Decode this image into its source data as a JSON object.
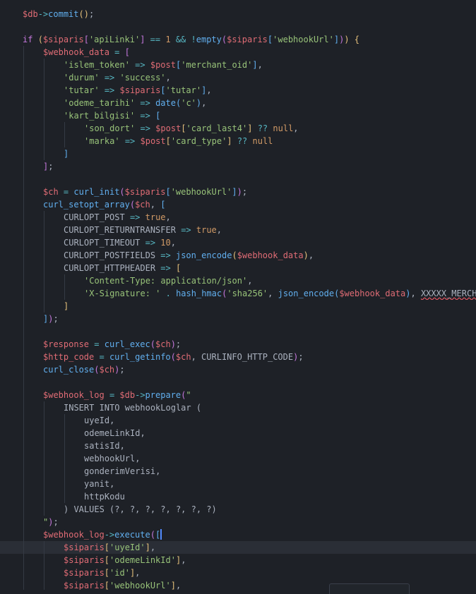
{
  "editor": {
    "language": "php",
    "theme": {
      "background": "#1e2127",
      "active_line": "#2a2e36",
      "variable": "#e06c75",
      "operator": "#56b6c2",
      "function": "#61afef",
      "keyword": "#c678dd",
      "string": "#98c379",
      "number": "#d19a66",
      "plain": "#abb2bf",
      "caret": "#528bff",
      "error_underline": "#e05561"
    },
    "active_line": 42,
    "lines": [
      {
        "indent": 0,
        "tokens": [
          [
            "var",
            "$db"
          ],
          [
            "op",
            "->"
          ],
          [
            "fn",
            "commit"
          ],
          [
            "br1",
            "()"
          ],
          [
            "punc",
            ";"
          ]
        ]
      },
      {
        "indent": 0,
        "tokens": []
      },
      {
        "indent": 0,
        "tokens": [
          [
            "kw",
            "if"
          ],
          [
            "plain",
            " "
          ],
          [
            "br1",
            "("
          ],
          [
            "var",
            "$siparis"
          ],
          [
            "br2",
            "["
          ],
          [
            "str",
            "'apiLinki'"
          ],
          [
            "br2",
            "]"
          ],
          [
            "plain",
            " "
          ],
          [
            "op",
            "=="
          ],
          [
            "plain",
            " "
          ],
          [
            "num",
            "1"
          ],
          [
            "plain",
            " "
          ],
          [
            "op",
            "&&"
          ],
          [
            "plain",
            " "
          ],
          [
            "op",
            "!"
          ],
          [
            "fn",
            "empty"
          ],
          [
            "br2",
            "("
          ],
          [
            "var",
            "$siparis"
          ],
          [
            "br3",
            "["
          ],
          [
            "str",
            "'webhookUrl'"
          ],
          [
            "br3",
            "]"
          ],
          [
            "br2",
            ")"
          ],
          [
            "br1",
            ")"
          ],
          [
            "plain",
            " "
          ],
          [
            "br1",
            "{"
          ]
        ]
      },
      {
        "indent": 1,
        "tokens": [
          [
            "var",
            "$webhook_data"
          ],
          [
            "plain",
            " "
          ],
          [
            "op",
            "="
          ],
          [
            "plain",
            " "
          ],
          [
            "br2",
            "["
          ]
        ]
      },
      {
        "indent": 2,
        "tokens": [
          [
            "str",
            "'islem_token'"
          ],
          [
            "plain",
            " "
          ],
          [
            "op",
            "=>"
          ],
          [
            "plain",
            " "
          ],
          [
            "var",
            "$post"
          ],
          [
            "br3",
            "["
          ],
          [
            "str",
            "'merchant_oid'"
          ],
          [
            "br3",
            "]"
          ],
          [
            "punc",
            ","
          ]
        ]
      },
      {
        "indent": 2,
        "tokens": [
          [
            "str",
            "'durum'"
          ],
          [
            "plain",
            " "
          ],
          [
            "op",
            "=>"
          ],
          [
            "plain",
            " "
          ],
          [
            "str",
            "'success'"
          ],
          [
            "punc",
            ","
          ]
        ]
      },
      {
        "indent": 2,
        "tokens": [
          [
            "str",
            "'tutar'"
          ],
          [
            "plain",
            " "
          ],
          [
            "op",
            "=>"
          ],
          [
            "plain",
            " "
          ],
          [
            "var",
            "$siparis"
          ],
          [
            "br3",
            "["
          ],
          [
            "str",
            "'tutar'"
          ],
          [
            "br3",
            "]"
          ],
          [
            "punc",
            ","
          ]
        ]
      },
      {
        "indent": 2,
        "tokens": [
          [
            "str",
            "'odeme_tarihi'"
          ],
          [
            "plain",
            " "
          ],
          [
            "op",
            "=>"
          ],
          [
            "plain",
            " "
          ],
          [
            "fn",
            "date"
          ],
          [
            "br3",
            "("
          ],
          [
            "str",
            "'c'"
          ],
          [
            "br3",
            ")"
          ],
          [
            "punc",
            ","
          ]
        ]
      },
      {
        "indent": 2,
        "tokens": [
          [
            "str",
            "'kart_bilgisi'"
          ],
          [
            "plain",
            " "
          ],
          [
            "op",
            "=>"
          ],
          [
            "plain",
            " "
          ],
          [
            "br3",
            "["
          ]
        ]
      },
      {
        "indent": 3,
        "tokens": [
          [
            "str",
            "'son_dort'"
          ],
          [
            "plain",
            " "
          ],
          [
            "op",
            "=>"
          ],
          [
            "plain",
            " "
          ],
          [
            "var",
            "$post"
          ],
          [
            "br1",
            "["
          ],
          [
            "str",
            "'card_last4'"
          ],
          [
            "br1",
            "]"
          ],
          [
            "plain",
            " "
          ],
          [
            "op",
            "??"
          ],
          [
            "plain",
            " "
          ],
          [
            "const",
            "null"
          ],
          [
            "punc",
            ","
          ]
        ]
      },
      {
        "indent": 3,
        "tokens": [
          [
            "str",
            "'marka'"
          ],
          [
            "plain",
            " "
          ],
          [
            "op",
            "=>"
          ],
          [
            "plain",
            " "
          ],
          [
            "var",
            "$post"
          ],
          [
            "br1",
            "["
          ],
          [
            "str",
            "'card_type'"
          ],
          [
            "br1",
            "]"
          ],
          [
            "plain",
            " "
          ],
          [
            "op",
            "??"
          ],
          [
            "plain",
            " "
          ],
          [
            "const",
            "null"
          ]
        ]
      },
      {
        "indent": 2,
        "tokens": [
          [
            "br3",
            "]"
          ]
        ]
      },
      {
        "indent": 1,
        "tokens": [
          [
            "br2",
            "]"
          ],
          [
            "punc",
            ";"
          ]
        ]
      },
      {
        "indent": 1,
        "tokens": []
      },
      {
        "indent": 1,
        "tokens": [
          [
            "var",
            "$ch"
          ],
          [
            "plain",
            " "
          ],
          [
            "op",
            "="
          ],
          [
            "plain",
            " "
          ],
          [
            "fn",
            "curl_init"
          ],
          [
            "br2",
            "("
          ],
          [
            "var",
            "$siparis"
          ],
          [
            "br3",
            "["
          ],
          [
            "str",
            "'webhookUrl'"
          ],
          [
            "br3",
            "]"
          ],
          [
            "br2",
            ")"
          ],
          [
            "punc",
            ";"
          ]
        ]
      },
      {
        "indent": 1,
        "tokens": [
          [
            "fn",
            "curl_setopt_array"
          ],
          [
            "br2",
            "("
          ],
          [
            "var",
            "$ch"
          ],
          [
            "punc",
            ","
          ],
          [
            "plain",
            " "
          ],
          [
            "br3",
            "["
          ]
        ]
      },
      {
        "indent": 2,
        "tokens": [
          [
            "plain",
            "CURLOPT_POST"
          ],
          [
            "plain",
            " "
          ],
          [
            "op",
            "=>"
          ],
          [
            "plain",
            " "
          ],
          [
            "const",
            "true"
          ],
          [
            "punc",
            ","
          ]
        ]
      },
      {
        "indent": 2,
        "tokens": [
          [
            "plain",
            "CURLOPT_RETURNTRANSFER"
          ],
          [
            "plain",
            " "
          ],
          [
            "op",
            "=>"
          ],
          [
            "plain",
            " "
          ],
          [
            "const",
            "true"
          ],
          [
            "punc",
            ","
          ]
        ]
      },
      {
        "indent": 2,
        "tokens": [
          [
            "plain",
            "CURLOPT_TIMEOUT"
          ],
          [
            "plain",
            " "
          ],
          [
            "op",
            "=>"
          ],
          [
            "plain",
            " "
          ],
          [
            "num",
            "10"
          ],
          [
            "punc",
            ","
          ]
        ]
      },
      {
        "indent": 2,
        "tokens": [
          [
            "plain",
            "CURLOPT_POSTFIELDS"
          ],
          [
            "plain",
            " "
          ],
          [
            "op",
            "=>"
          ],
          [
            "plain",
            " "
          ],
          [
            "fn",
            "json_encode"
          ],
          [
            "br1",
            "("
          ],
          [
            "var",
            "$webhook_data"
          ],
          [
            "br1",
            ")"
          ],
          [
            "punc",
            ","
          ]
        ]
      },
      {
        "indent": 2,
        "tokens": [
          [
            "plain",
            "CURLOPT_HTTPHEADER"
          ],
          [
            "plain",
            " "
          ],
          [
            "op",
            "=>"
          ],
          [
            "plain",
            " "
          ],
          [
            "br1",
            "["
          ]
        ]
      },
      {
        "indent": 3,
        "tokens": [
          [
            "str",
            "'Content-Type: application/json'"
          ],
          [
            "punc",
            ","
          ]
        ]
      },
      {
        "indent": 3,
        "tokens": [
          [
            "str",
            "'X-Signature: '"
          ],
          [
            "plain",
            " "
          ],
          [
            "op",
            "."
          ],
          [
            "plain",
            " "
          ],
          [
            "fn",
            "hash_hmac"
          ],
          [
            "br2",
            "("
          ],
          [
            "str",
            "'sha256'"
          ],
          [
            "punc",
            ","
          ],
          [
            "plain",
            " "
          ],
          [
            "fn",
            "json_encode"
          ],
          [
            "br3",
            "("
          ],
          [
            "var",
            "$webhook_data"
          ],
          [
            "br3",
            ")"
          ],
          [
            "punc",
            ","
          ],
          [
            "plain",
            " "
          ],
          [
            "err",
            "XXXXX_MERCHANT_KEY"
          ]
        ]
      },
      {
        "indent": 2,
        "tokens": [
          [
            "br1",
            "]"
          ]
        ]
      },
      {
        "indent": 1,
        "tokens": [
          [
            "br3",
            "]"
          ],
          [
            "br2",
            ")"
          ],
          [
            "punc",
            ";"
          ]
        ]
      },
      {
        "indent": 1,
        "tokens": []
      },
      {
        "indent": 1,
        "tokens": [
          [
            "var",
            "$response"
          ],
          [
            "plain",
            " "
          ],
          [
            "op",
            "="
          ],
          [
            "plain",
            " "
          ],
          [
            "fn",
            "curl_exec"
          ],
          [
            "br2",
            "("
          ],
          [
            "var",
            "$ch"
          ],
          [
            "br2",
            ")"
          ],
          [
            "punc",
            ";"
          ]
        ]
      },
      {
        "indent": 1,
        "tokens": [
          [
            "var",
            "$http_code"
          ],
          [
            "plain",
            " "
          ],
          [
            "op",
            "="
          ],
          [
            "plain",
            " "
          ],
          [
            "fn",
            "curl_getinfo"
          ],
          [
            "br2",
            "("
          ],
          [
            "var",
            "$ch"
          ],
          [
            "punc",
            ","
          ],
          [
            "plain",
            " "
          ],
          [
            "plain",
            "CURLINFO_HTTP_CODE"
          ],
          [
            "br2",
            ")"
          ],
          [
            "punc",
            ";"
          ]
        ]
      },
      {
        "indent": 1,
        "tokens": [
          [
            "fn",
            "curl_close"
          ],
          [
            "br2",
            "("
          ],
          [
            "var",
            "$ch"
          ],
          [
            "br2",
            ")"
          ],
          [
            "punc",
            ";"
          ]
        ]
      },
      {
        "indent": 1,
        "tokens": []
      },
      {
        "indent": 1,
        "tokens": [
          [
            "var",
            "$webhook_log"
          ],
          [
            "plain",
            " "
          ],
          [
            "op",
            "="
          ],
          [
            "plain",
            " "
          ],
          [
            "var",
            "$db"
          ],
          [
            "op",
            "->"
          ],
          [
            "fn",
            "prepare"
          ],
          [
            "br2",
            "("
          ],
          [
            "str",
            "\""
          ]
        ]
      },
      {
        "indent": 2,
        "tokens": [
          [
            "plain",
            "INSERT INTO webhookLoglar ("
          ]
        ]
      },
      {
        "indent": 3,
        "tokens": [
          [
            "plain",
            "uyeId,"
          ]
        ]
      },
      {
        "indent": 3,
        "tokens": [
          [
            "plain",
            "odemeLinkId,"
          ]
        ]
      },
      {
        "indent": 3,
        "tokens": [
          [
            "plain",
            "satisId,"
          ]
        ]
      },
      {
        "indent": 3,
        "tokens": [
          [
            "plain",
            "webhookUrl,"
          ]
        ]
      },
      {
        "indent": 3,
        "tokens": [
          [
            "plain",
            "gonderimVerisi,"
          ]
        ]
      },
      {
        "indent": 3,
        "tokens": [
          [
            "plain",
            "yanit,"
          ]
        ]
      },
      {
        "indent": 3,
        "tokens": [
          [
            "plain",
            "httpKodu"
          ]
        ]
      },
      {
        "indent": 2,
        "tokens": [
          [
            "plain",
            ") VALUES (?, ?, ?, ?, ?, ?, ?)"
          ]
        ]
      },
      {
        "indent": 1,
        "tokens": [
          [
            "str",
            "\""
          ],
          [
            "br2",
            ")"
          ],
          [
            "punc",
            ";"
          ]
        ]
      },
      {
        "indent": 1,
        "tokens": [
          [
            "var",
            "$webhook_log"
          ],
          [
            "op",
            "->"
          ],
          [
            "fn",
            "execute"
          ],
          [
            "br2",
            "("
          ],
          [
            "br3",
            "["
          ],
          [
            "caret",
            ""
          ]
        ]
      },
      {
        "indent": 2,
        "tokens": [
          [
            "var",
            "$siparis"
          ],
          [
            "br1",
            "["
          ],
          [
            "str",
            "'uyeId'"
          ],
          [
            "br1",
            "]"
          ],
          [
            "punc",
            ","
          ]
        ]
      },
      {
        "indent": 2,
        "tokens": [
          [
            "var",
            "$siparis"
          ],
          [
            "br1",
            "["
          ],
          [
            "str",
            "'odemeLinkId'"
          ],
          [
            "br1",
            "]"
          ],
          [
            "punc",
            ","
          ]
        ]
      },
      {
        "indent": 2,
        "tokens": [
          [
            "var",
            "$siparis"
          ],
          [
            "br1",
            "["
          ],
          [
            "str",
            "'id'"
          ],
          [
            "br1",
            "]"
          ],
          [
            "punc",
            ","
          ]
        ]
      },
      {
        "indent": 2,
        "tokens": [
          [
            "var",
            "$siparis"
          ],
          [
            "br1",
            "["
          ],
          [
            "str",
            "'webhookUrl'"
          ],
          [
            "br1",
            "]"
          ],
          [
            "punc",
            ","
          ]
        ]
      }
    ]
  }
}
